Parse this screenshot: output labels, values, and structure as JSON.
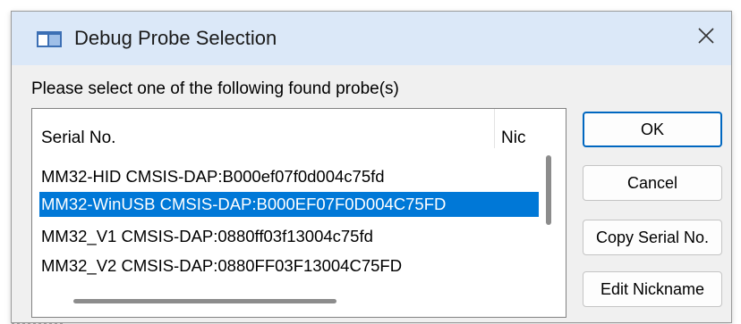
{
  "window": {
    "title": "Debug Probe Selection",
    "icon": "app-window-icon",
    "close_icon": "close-icon",
    "accent": "#0078d7",
    "titlebar_color": "#dbe8f8"
  },
  "prompt": "Please select one of the following found probe(s)",
  "probe_list": {
    "columns": [
      "Serial No.",
      "Nic"
    ],
    "rows": [
      {
        "serial": "MM32-HID CMSIS-DAP:B000ef07f0d004c75fd",
        "selected": false
      },
      {
        "serial": "MM32-WinUSB CMSIS-DAP:B000EF07F0D004C75FD",
        "selected": true
      },
      {
        "serial": "MM32_V1 CMSIS-DAP:0880ff03f13004c75fd",
        "selected": false
      },
      {
        "serial": "MM32_V2 CMSIS-DAP:0880FF03F13004C75FD",
        "selected": false
      }
    ]
  },
  "buttons": {
    "ok": "OK",
    "cancel": "Cancel",
    "copy_serial": "Copy Serial No.",
    "edit_nickname": "Edit Nickname"
  }
}
